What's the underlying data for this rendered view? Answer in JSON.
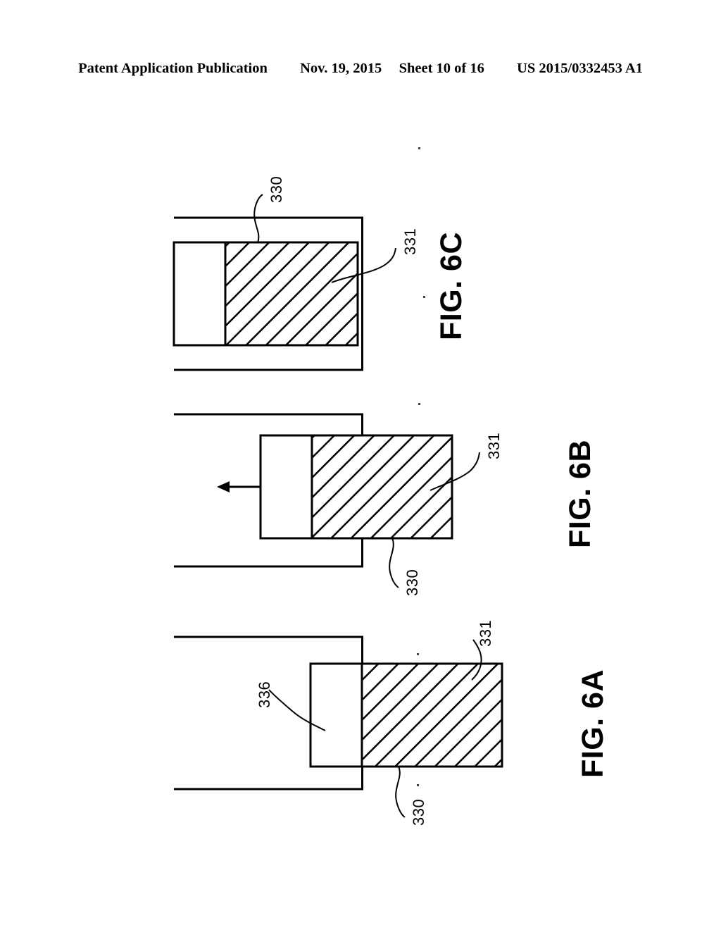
{
  "header": {
    "publication_label": "Patent Application Publication",
    "date": "Nov. 19, 2015",
    "sheet": "Sheet 10 of 16",
    "publication_number": "US 2015/0332453 A1"
  },
  "figures": [
    {
      "id": "fig-6c",
      "caption": "FIG. 6C",
      "description": "Block fully retracted inside channel; hatched portion ends flush with channel end wall",
      "refs": [
        {
          "name": "330",
          "label": "330",
          "target": "block-outline"
        },
        {
          "name": "331",
          "label": "331",
          "target": "hatched-portion"
        }
      ],
      "arrow": null
    },
    {
      "id": "fig-6b",
      "caption": "FIG. 6B",
      "description": "Block partially withdrawn from channel, motion arrow pointing into channel",
      "refs": [
        {
          "name": "330",
          "label": "330",
          "target": "block-outline"
        },
        {
          "name": "331",
          "label": "331",
          "target": "hatched-portion"
        }
      ],
      "arrow": {
        "name": "motion-arrow",
        "direction": "left"
      }
    },
    {
      "id": "fig-6a",
      "caption": "FIG. 6A",
      "description": "Block extended out of channel; plain portion inside channel, hatched portion outside",
      "refs": [
        {
          "name": "336",
          "label": "336",
          "target": "plain-portion"
        },
        {
          "name": "330",
          "label": "330",
          "target": "block-outline"
        },
        {
          "name": "331",
          "label": "331",
          "target": "hatched-portion"
        }
      ],
      "arrow": null
    }
  ],
  "colors": {
    "line": "#000000",
    "background": "#ffffff"
  }
}
